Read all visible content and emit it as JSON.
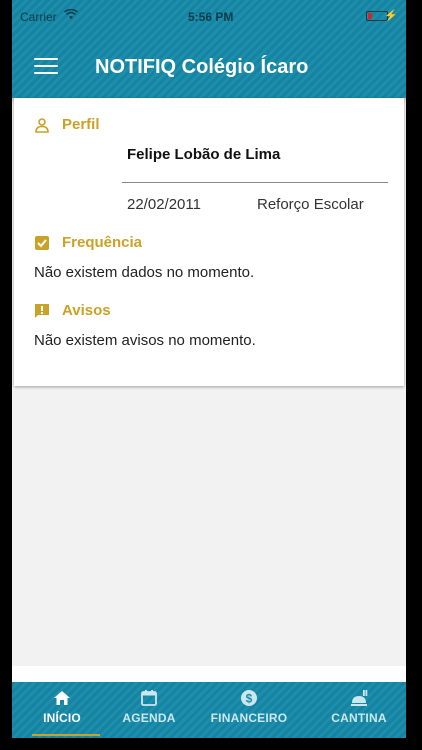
{
  "status_bar": {
    "carrier": "Carrier",
    "time": "5:56 PM"
  },
  "header": {
    "title": "NOTIFIQ Colégio Ícaro",
    "menu_icon": "hamburger-menu-icon"
  },
  "profile": {
    "section_label": "Perfil",
    "icon": "person-icon",
    "student_name": "Felipe Lobão de Lima",
    "birth_date": "22/02/2011",
    "course": "Reforço Escolar"
  },
  "attendance": {
    "section_label": "Frequência",
    "icon": "checkbox-icon",
    "message": "Não existem dados no momento."
  },
  "notices": {
    "section_label": "Avisos",
    "icon": "alert-icon",
    "message": "Não existem avisos no momento."
  },
  "bottom_nav": {
    "items": [
      {
        "label": "INÍCIO",
        "icon": "home-icon",
        "active": true
      },
      {
        "label": "AGENDA",
        "icon": "calendar-icon",
        "active": false
      },
      {
        "label": "FINANCEIRO",
        "icon": "dollar-icon",
        "active": false
      },
      {
        "label": "CANTINA",
        "icon": "food-icon",
        "active": false
      }
    ]
  },
  "colors": {
    "primary": "#1b8fad",
    "accent": "#c9a227",
    "background": "#f2f2f2"
  }
}
